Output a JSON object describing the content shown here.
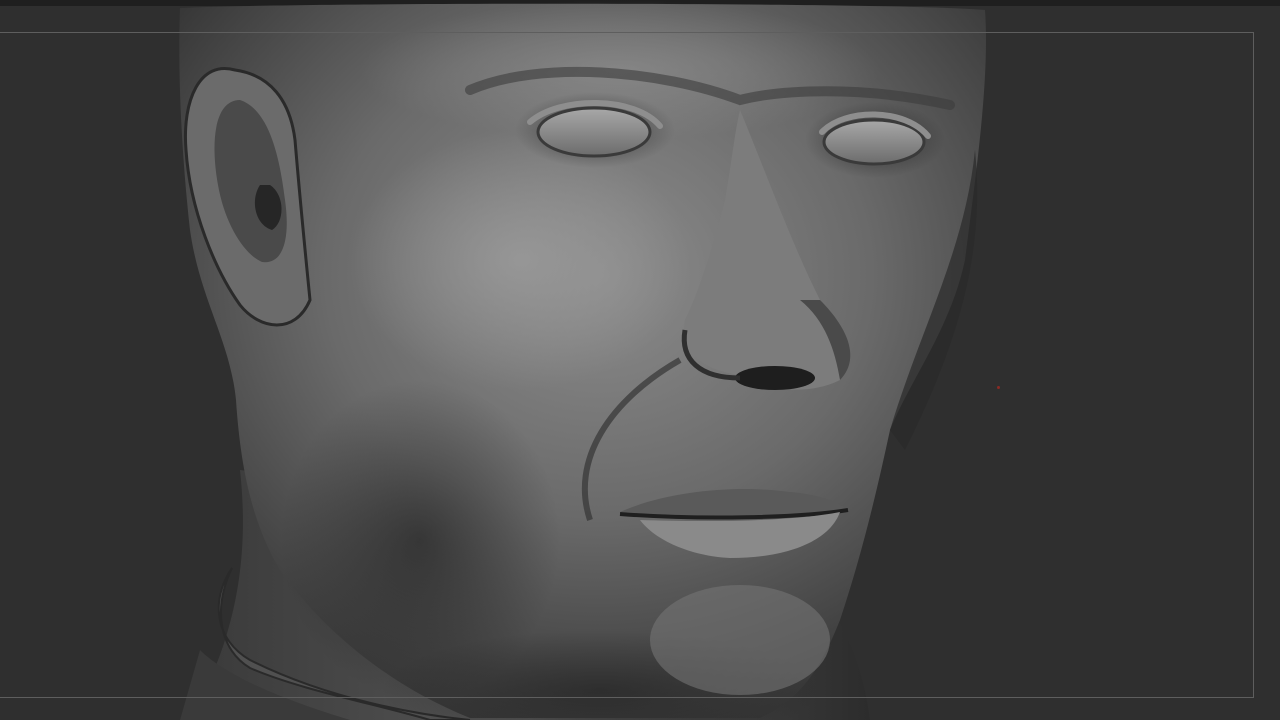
{
  "viewport": {
    "background_color": "#2f2f2f",
    "frame_color": "#5e5e5e",
    "model_base_color": "#6e6e6e",
    "marker_color": "#8a2a24"
  }
}
